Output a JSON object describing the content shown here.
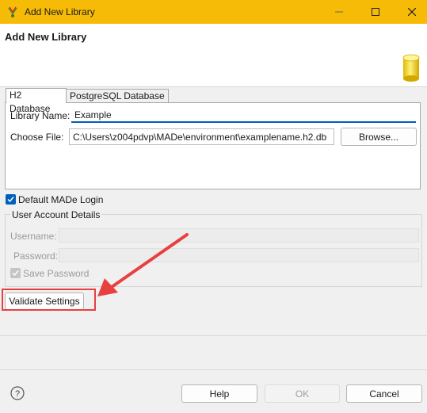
{
  "window": {
    "title": "Add New Library",
    "accent_color": "#f6bb06"
  },
  "banner": {
    "title": "Add New Library",
    "icon": "database-cylinder-icon"
  },
  "tabs": [
    {
      "label": "H2 Database",
      "selected": true
    },
    {
      "label": "PostgreSQL Database",
      "selected": false
    }
  ],
  "form": {
    "library_name_label": "Library Name:",
    "library_name_value": "Example",
    "choose_file_label": "Choose File:",
    "choose_file_value": "C:\\Users\\z004pdvp\\MADe\\environment\\examplename.h2.db",
    "browse_label": "Browse...",
    "default_login_label": "Default MADe Login",
    "default_login_checked": true
  },
  "account": {
    "group_title": "User Account Details",
    "username_label": "Username:",
    "password_label": "Password:",
    "save_password_label": "Save Password",
    "save_password_checked": true
  },
  "actions": {
    "validate_label": "Validate Settings"
  },
  "footer": {
    "help_label": "Help",
    "ok_label": "OK",
    "cancel_label": "Cancel"
  },
  "annotation": {
    "color": "#e84040"
  }
}
